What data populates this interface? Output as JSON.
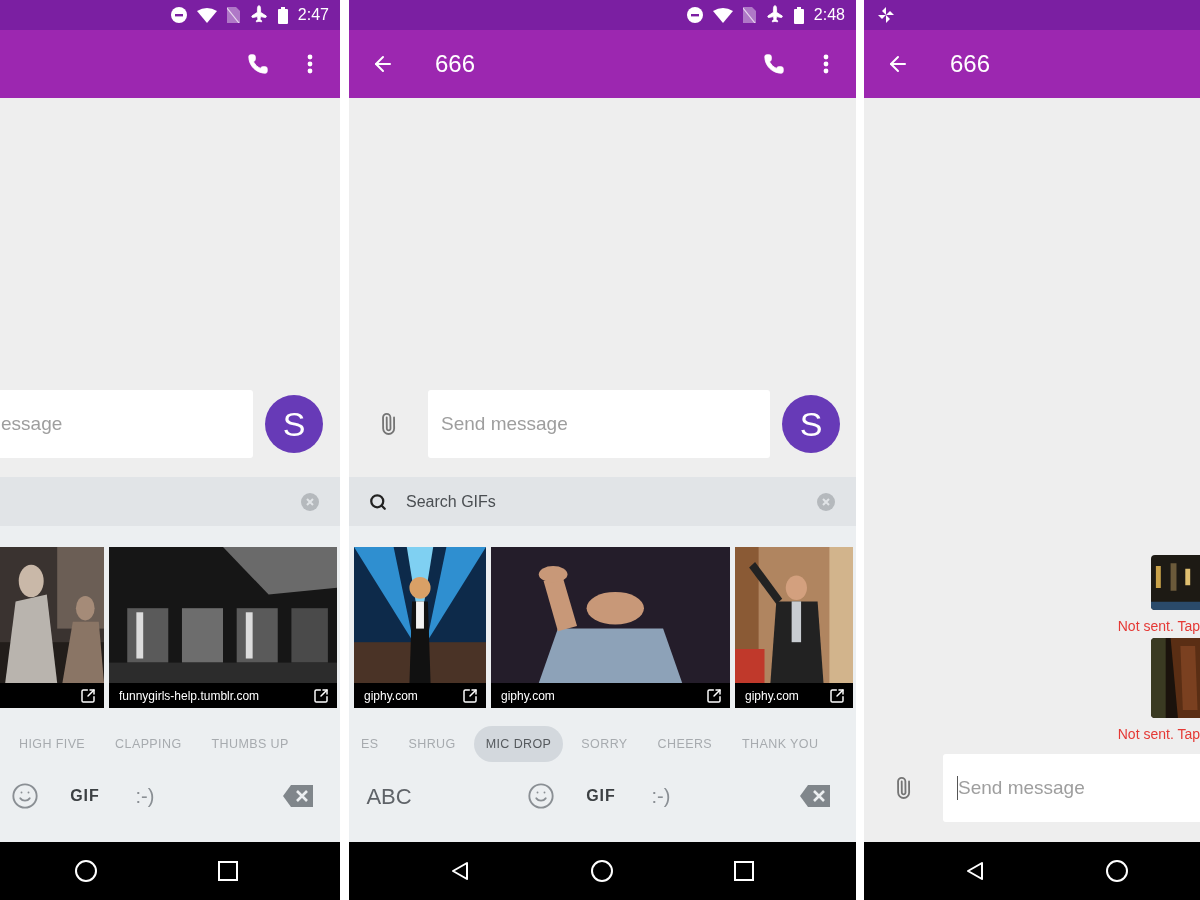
{
  "screens": [
    {
      "kind": "gif_keyboard",
      "status_bar": {
        "time": "2:47"
      },
      "composer": {
        "placeholder": "essage",
        "focused": false
      },
      "avatar": {
        "letter": "S"
      },
      "gifs": [
        {
          "kind": "picture"
        },
        {
          "kind": "picture",
          "source": "funnygirls-help.tumblr.com"
        }
      ],
      "categories": [
        {
          "label": "HIGH FIVE",
          "selected": false
        },
        {
          "label": "CLAPPING",
          "selected": false
        },
        {
          "label": "THUMBS UP",
          "selected": false
        }
      ],
      "keys": [
        {
          "kind": "emoji",
          "selected": false
        },
        {
          "kind": "gif",
          "label": "GIF",
          "selected": true
        },
        {
          "kind": "emoticon",
          "label": ":-)",
          "selected": false
        },
        {
          "kind": "backspace"
        }
      ],
      "nav": [
        {
          "kind": "home"
        },
        {
          "kind": "recents"
        }
      ]
    },
    {
      "kind": "gif_keyboard",
      "status_bar": {
        "time": "2:48"
      },
      "toolbar": {
        "title": "666"
      },
      "composer": {
        "placeholder": "Send message",
        "focused": false
      },
      "avatar": {
        "letter": "S"
      },
      "gif_search": {
        "placeholder": "Search GIFs"
      },
      "gifs": [
        {
          "kind": "picture",
          "source": "giphy.com"
        },
        {
          "kind": "picture",
          "source": "giphy.com"
        },
        {
          "kind": "picture",
          "source": "giphy.com"
        }
      ],
      "categories": [
        {
          "label": "ES",
          "selected": false
        },
        {
          "label": "SHRUG",
          "selected": false
        },
        {
          "label": "MIC DROP",
          "selected": true
        },
        {
          "label": "SORRY",
          "selected": false
        },
        {
          "label": "CHEERS",
          "selected": false
        },
        {
          "label": "THANK YOU",
          "selected": false
        }
      ],
      "keys": [
        {
          "kind": "abc",
          "label": "ABC"
        },
        {
          "kind": "emoji",
          "selected": false
        },
        {
          "kind": "gif",
          "label": "GIF",
          "selected": true
        },
        {
          "kind": "emoticon",
          "label": ":-)",
          "selected": false
        },
        {
          "kind": "backspace"
        }
      ],
      "nav": [
        {
          "kind": "back"
        },
        {
          "kind": "home"
        },
        {
          "kind": "recents"
        }
      ]
    },
    {
      "kind": "conversation",
      "toolbar": {
        "title": "666"
      },
      "messages": [
        {
          "kind": "picture",
          "status": "Not sent. Tap"
        },
        {
          "kind": "picture",
          "status": "Not sent. Tap"
        }
      ],
      "composer": {
        "placeholder": "Send message",
        "focused": true
      },
      "nav": [
        {
          "kind": "back"
        },
        {
          "kind": "home"
        }
      ]
    }
  ]
}
